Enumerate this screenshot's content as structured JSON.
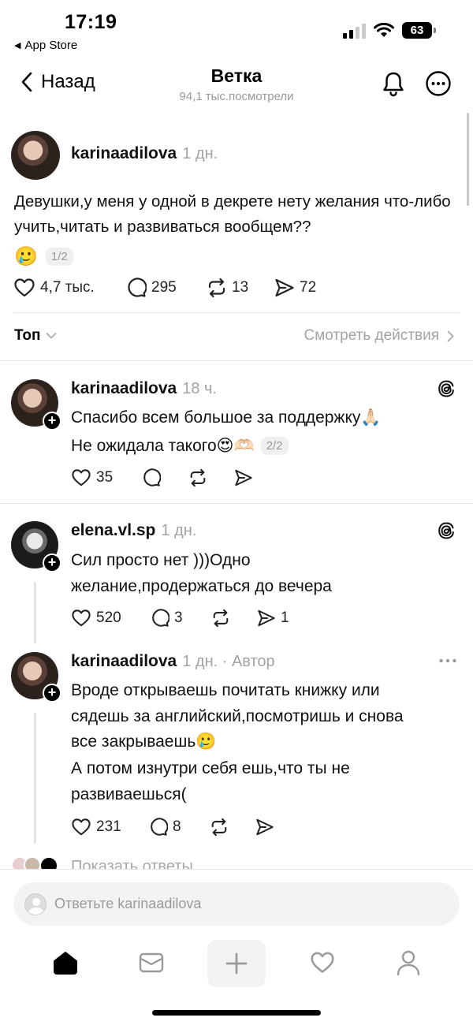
{
  "status_bar": {
    "time": "17:19",
    "back_app": "App Store",
    "battery": "63"
  },
  "header": {
    "back_label": "Назад",
    "title": "Ветка",
    "views": "94,1 тыс.посмотрели"
  },
  "main_post": {
    "username": "karinaadilova",
    "time": "1 дн.",
    "text": "Девушки,у меня у одной в декрете нету желания что-либо учить,читать и развиваться вообщем??",
    "emoji": "🥲",
    "page": "1/2",
    "likes": "4,7 тыс.",
    "comments": "295",
    "reposts": "13",
    "shares": "72"
  },
  "sort_bar": {
    "sort_label": "Топ",
    "activity_link": "Смотреть действия"
  },
  "replies": [
    {
      "username": "karinaadilova",
      "time": "18 ч.",
      "line1": "Спасибо всем большое за поддержку🙏🏻",
      "line2": "Не ожидала такого😍🫶🏻",
      "page": "2/2",
      "likes": "35"
    },
    {
      "username": "elena.vl.sp",
      "time": "1 дн.",
      "line1": "Сил просто нет )))Одно",
      "line2": "желание,продержаться до вечера",
      "likes": "520",
      "comments": "3",
      "shares": "1"
    },
    {
      "username": "karinaadilova",
      "time": "1 дн. · Автор",
      "line1": "Вроде открываешь почитать книжку или",
      "line2": "сядешь за английский,посмотришь и снова",
      "line3": "все закрываешь🥲",
      "line4": "А потом изнутри себя ешь,что ты не",
      "line5": "развиваешься(",
      "likes": "231",
      "comments": "8"
    }
  ],
  "show_replies": "Показать ответы",
  "reply_bar": {
    "placeholder": "Ответьте karinaadilova"
  }
}
